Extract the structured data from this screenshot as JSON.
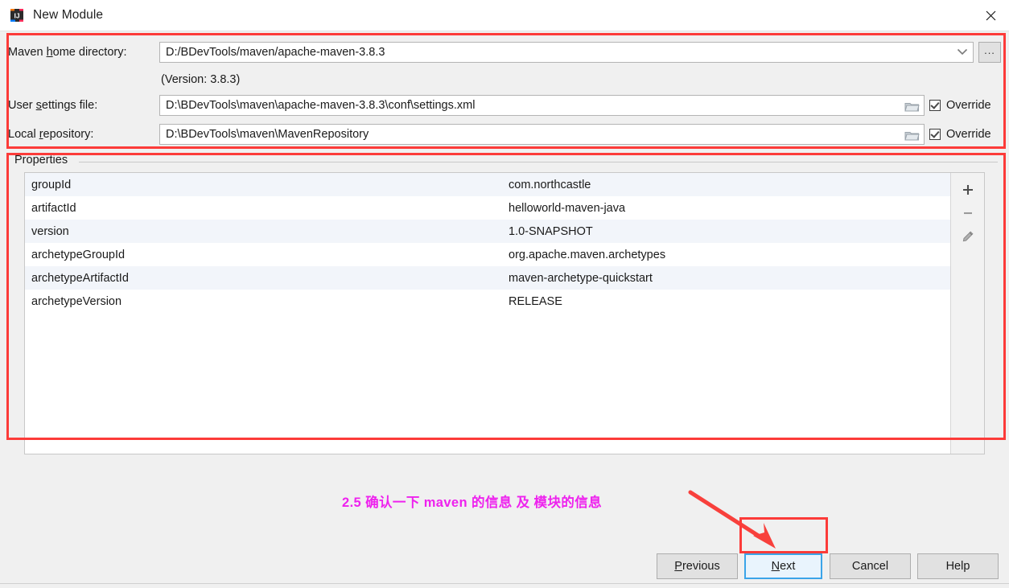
{
  "window": {
    "title": "New Module",
    "app_icon": "intellij-idea-icon",
    "close_icon": "close-icon"
  },
  "form": {
    "maven_home": {
      "label_pre": "Maven ",
      "label_mnemonic": "h",
      "label_post": "ome directory:",
      "value": "D:/BDevTools/maven/apache-maven-3.8.3",
      "dropdown_icon": "chevron-down-icon",
      "browse_label": "..."
    },
    "version_note": "(Version: 3.8.3)",
    "user_settings": {
      "label_pre": "User ",
      "label_mnemonic": "s",
      "label_post": "ettings file:",
      "value": "D:\\BDevTools\\maven\\apache-maven-3.8.3\\conf\\settings.xml",
      "folder_icon": "folder-icon",
      "override_label": "Override",
      "override_checked": true
    },
    "local_repository": {
      "label_pre": "Local ",
      "label_mnemonic": "r",
      "label_post": "epository:",
      "value": "D:\\BDevTools\\maven\\MavenRepository",
      "folder_icon": "folder-icon",
      "override_label": "Override",
      "override_checked": true
    }
  },
  "properties": {
    "legend": "Properties",
    "rows": [
      {
        "name": "groupId",
        "value": "com.northcastle"
      },
      {
        "name": "artifactId",
        "value": "helloworld-maven-java"
      },
      {
        "name": "version",
        "value": "1.0-SNAPSHOT"
      },
      {
        "name": "archetypeGroupId",
        "value": "org.apache.maven.archetypes"
      },
      {
        "name": "archetypeArtifactId",
        "value": "maven-archetype-quickstart"
      },
      {
        "name": "archetypeVersion",
        "value": "RELEASE"
      }
    ],
    "toolbar": [
      {
        "icon": "plus-icon",
        "title": "Add"
      },
      {
        "icon": "minus-icon",
        "title": "Remove"
      },
      {
        "icon": "pencil-icon",
        "title": "Edit"
      }
    ]
  },
  "annotation": {
    "text": "2.5 确认一下 maven 的信息 及 模块的信息",
    "color": "#ee22ee",
    "arrow_color": "#f8403c"
  },
  "buttons": {
    "previous": {
      "pre": "",
      "mnemonic": "P",
      "post": "revious"
    },
    "next": {
      "pre": "",
      "mnemonic": "N",
      "post": "ext",
      "focused": true
    },
    "cancel": {
      "pre": "Cancel",
      "mnemonic": "",
      "post": ""
    },
    "help": {
      "pre": "Help",
      "mnemonic": "",
      "post": ""
    }
  },
  "highlight": {
    "color": "#fc3b39"
  }
}
